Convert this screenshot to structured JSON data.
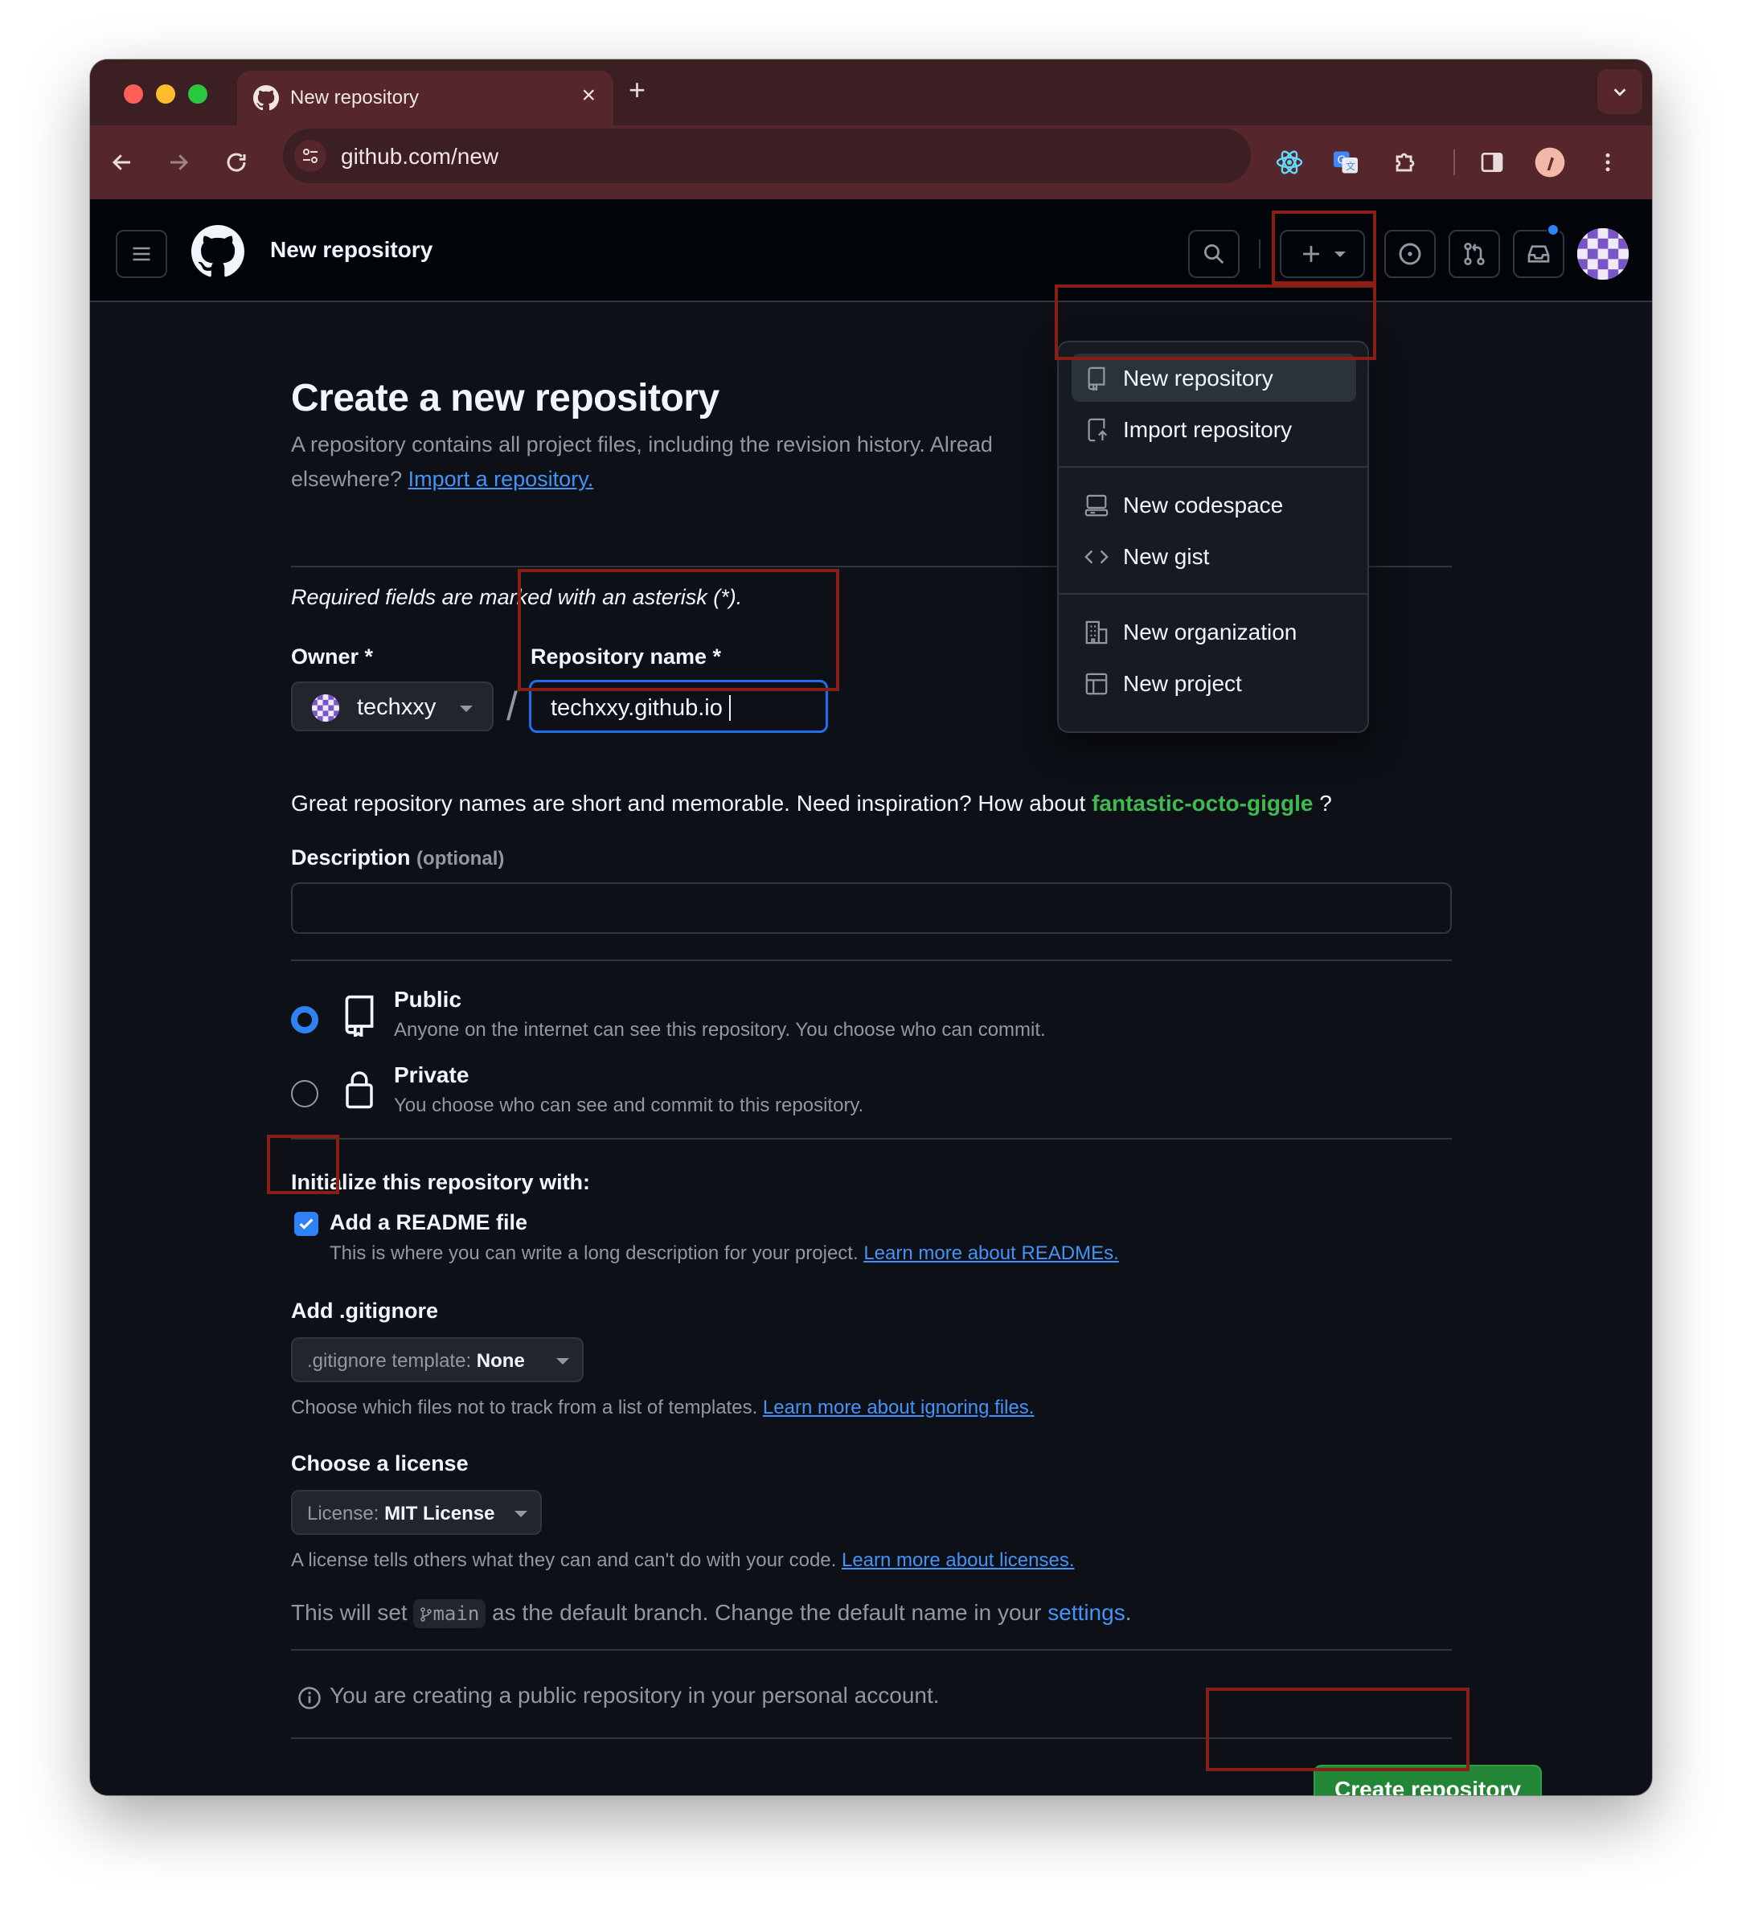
{
  "browser": {
    "tab_title": "New repository",
    "url": "github.com/new"
  },
  "header": {
    "title": "New repository"
  },
  "create_menu": {
    "items": [
      {
        "label": "New repository",
        "icon": "repo-icon"
      },
      {
        "label": "Import repository",
        "icon": "repo-push-icon"
      },
      {
        "label": "New codespace",
        "icon": "codespaces-icon"
      },
      {
        "label": "New gist",
        "icon": "code-icon"
      },
      {
        "label": "New organization",
        "icon": "organization-icon"
      },
      {
        "label": "New project",
        "icon": "table-icon"
      }
    ]
  },
  "form": {
    "heading": "Create a new repository",
    "lead": "A repository contains all project files, including the revision history. Alread",
    "lead_line2": "elsewhere?",
    "import_link": "Import a repository.",
    "required_note": "Required fields are marked with an asterisk (*).",
    "owner_label": "Owner *",
    "owner_value": "techxxy",
    "slash": "/",
    "repo_name_label": "Repository name *",
    "repo_name_value": "techxxy.github.io",
    "hint_prefix": "Great repository names are short and memorable. Need inspiration? How about",
    "hint_suggestion": "fantastic-octo-giggle",
    "hint_suffix": "?",
    "description_label": "Description",
    "description_optional": "(optional)",
    "description_value": "",
    "visibility": {
      "selected": "Public",
      "public_title": "Public",
      "public_desc": "Anyone on the internet can see this repository. You choose who can commit.",
      "private_title": "Private",
      "private_desc": "You choose who can see and commit to this repository."
    },
    "init_label": "Initialize this repository with:",
    "readme_checked": true,
    "readme_label": "Add a README file",
    "readme_desc": "This is where you can write a long description for your project.",
    "readme_link": "Learn more about READMEs.",
    "gitignore_label": "Add .gitignore",
    "gitignore_prefix": ".gitignore template:",
    "gitignore_value": "None",
    "gitignore_desc": "Choose which files not to track from a list of templates.",
    "gitignore_link": "Learn more about ignoring files.",
    "license_label": "Choose a license",
    "license_prefix": "License:",
    "license_value": "MIT License",
    "license_desc": "A license tells others what they can and can't do with your code.",
    "license_link": "Learn more about licenses.",
    "branch_prefix": "This will set",
    "branch_name": "main",
    "branch_middle": "as the default branch. Change the default name in your",
    "branch_link": "settings",
    "branch_suffix": ".",
    "info_note": "You are creating a public repository in your personal account.",
    "create_button": "Create repository"
  },
  "colors": {
    "background": "#0d1117",
    "header": "#010409",
    "accent_blue": "#2f81f7",
    "success_green": "#238636",
    "suggestion_green": "#3fb950",
    "annotation_red": "#8a1d14"
  }
}
